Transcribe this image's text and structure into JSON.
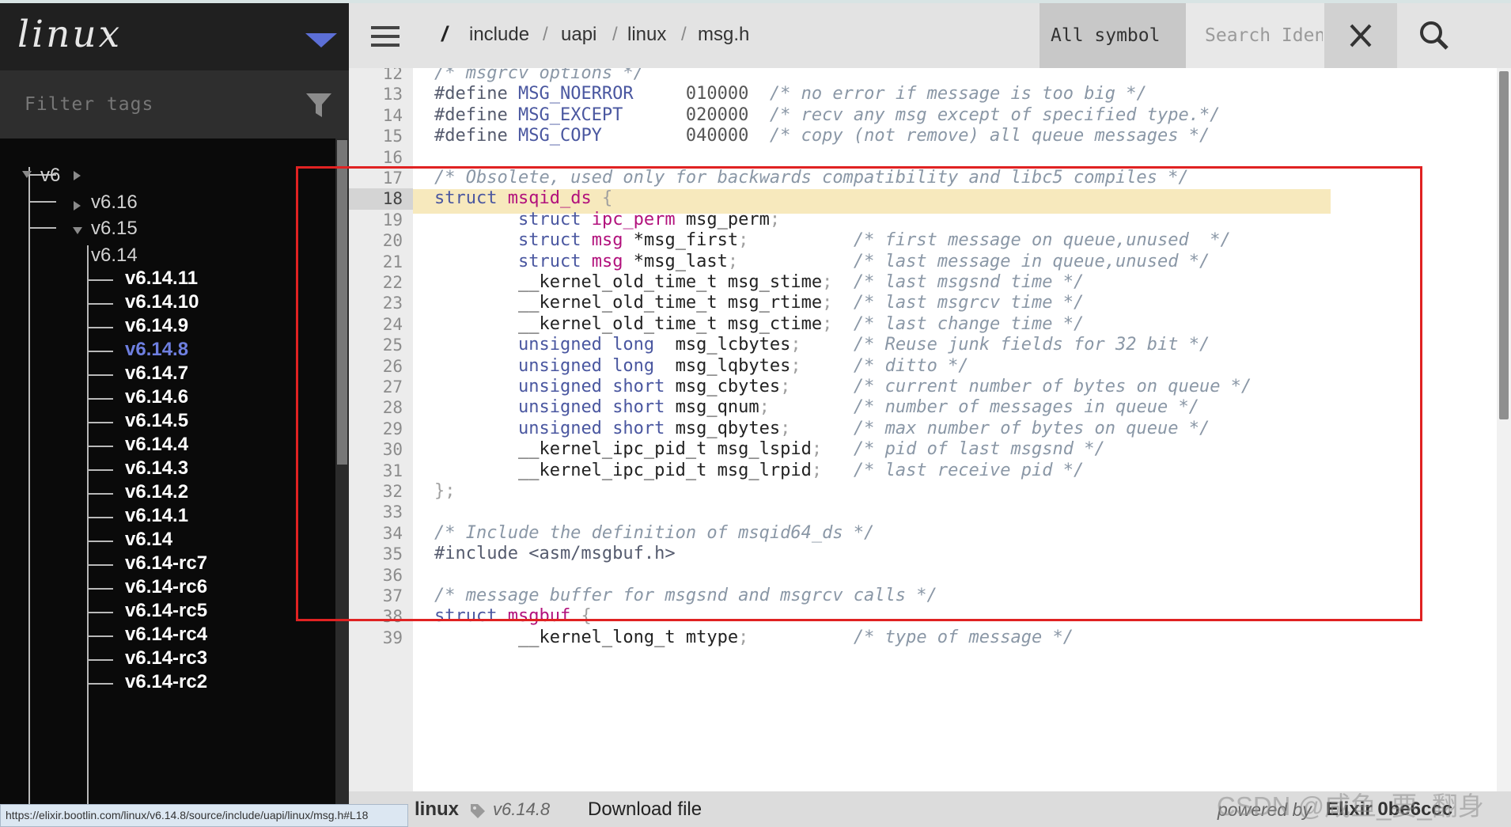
{
  "sidebar": {
    "project": "linux",
    "filter_placeholder": "Filter tags",
    "tree": {
      "root": "v6",
      "collapsed_versions": [
        "v6.16",
        "v6.15"
      ],
      "expanded_version": "v6.14",
      "tags": [
        "v6.14.11",
        "v6.14.10",
        "v6.14.9",
        "v6.14.8",
        "v6.14.7",
        "v6.14.6",
        "v6.14.5",
        "v6.14.4",
        "v6.14.3",
        "v6.14.2",
        "v6.14.1",
        "v6.14",
        "v6.14-rc7",
        "v6.14-rc6",
        "v6.14-rc5",
        "v6.14-rc4",
        "v6.14-rc3",
        "v6.14-rc2"
      ],
      "active_tag": "v6.14.8"
    }
  },
  "topbar": {
    "breadcrumb_root": "/",
    "breadcrumb": [
      "include",
      "uapi",
      "linux",
      "msg.h"
    ],
    "symbol_select": "All symbol",
    "search_placeholder": "Search Identifier"
  },
  "code": {
    "highlighted_line": 18,
    "lines": [
      {
        "n": "12",
        "code": "/* msgrcv options */"
      },
      {
        "n": "13",
        "code": "#define MSG_NOERROR     010000  /* no error if message is too big */"
      },
      {
        "n": "14",
        "code": "#define MSG_EXCEPT      020000  /* recv any msg except of specified type.*/"
      },
      {
        "n": "15",
        "code": "#define MSG_COPY        040000  /* copy (not remove) all queue messages */"
      },
      {
        "n": "16",
        "code": ""
      },
      {
        "n": "17",
        "code": "/* Obsolete, used only for backwards compatibility and libc5 compiles */"
      },
      {
        "n": "18",
        "code": "struct msqid_ds {"
      },
      {
        "n": "19",
        "code": "        struct ipc_perm msg_perm;"
      },
      {
        "n": "20",
        "code": "        struct msg *msg_first;          /* first message on queue,unused  */"
      },
      {
        "n": "21",
        "code": "        struct msg *msg_last;           /* last message in queue,unused */"
      },
      {
        "n": "22",
        "code": "        __kernel_old_time_t msg_stime;  /* last msgsnd time */"
      },
      {
        "n": "23",
        "code": "        __kernel_old_time_t msg_rtime;  /* last msgrcv time */"
      },
      {
        "n": "24",
        "code": "        __kernel_old_time_t msg_ctime;  /* last change time */"
      },
      {
        "n": "25",
        "code": "        unsigned long  msg_lcbytes;     /* Reuse junk fields for 32 bit */"
      },
      {
        "n": "26",
        "code": "        unsigned long  msg_lqbytes;     /* ditto */"
      },
      {
        "n": "27",
        "code": "        unsigned short msg_cbytes;      /* current number of bytes on queue */"
      },
      {
        "n": "28",
        "code": "        unsigned short msg_qnum;        /* number of messages in queue */"
      },
      {
        "n": "29",
        "code": "        unsigned short msg_qbytes;      /* max number of bytes on queue */"
      },
      {
        "n": "30",
        "code": "        __kernel_ipc_pid_t msg_lspid;   /* pid of last msgsnd */"
      },
      {
        "n": "31",
        "code": "        __kernel_ipc_pid_t msg_lrpid;   /* last receive pid */"
      },
      {
        "n": "32",
        "code": "};"
      },
      {
        "n": "33",
        "code": ""
      },
      {
        "n": "34",
        "code": "/* Include the definition of msqid64_ds */"
      },
      {
        "n": "35",
        "code": "#include <asm/msgbuf.h>"
      },
      {
        "n": "36",
        "code": ""
      },
      {
        "n": "37",
        "code": "/* message buffer for msgsnd and msgrcv calls */"
      },
      {
        "n": "38",
        "code": "struct msgbuf {"
      },
      {
        "n": "39",
        "code": "        __kernel_long_t mtype;          /* type of message */"
      }
    ]
  },
  "footer": {
    "project": "linux",
    "version": "v6.14.8",
    "download": "Download file",
    "powered_by": "powered by",
    "engine": "Elixir 0be6ccc"
  },
  "status_url": "https://elixir.bootlin.com/linux/v6.14.8/source/include/uapi/linux/msg.h#L18",
  "watermark": "CSDN @咸鱼_要_翻身",
  "colors": {
    "accent": "#5c6fd6",
    "highlight": "#f7e9bd",
    "annotation_box": "#e02222"
  }
}
